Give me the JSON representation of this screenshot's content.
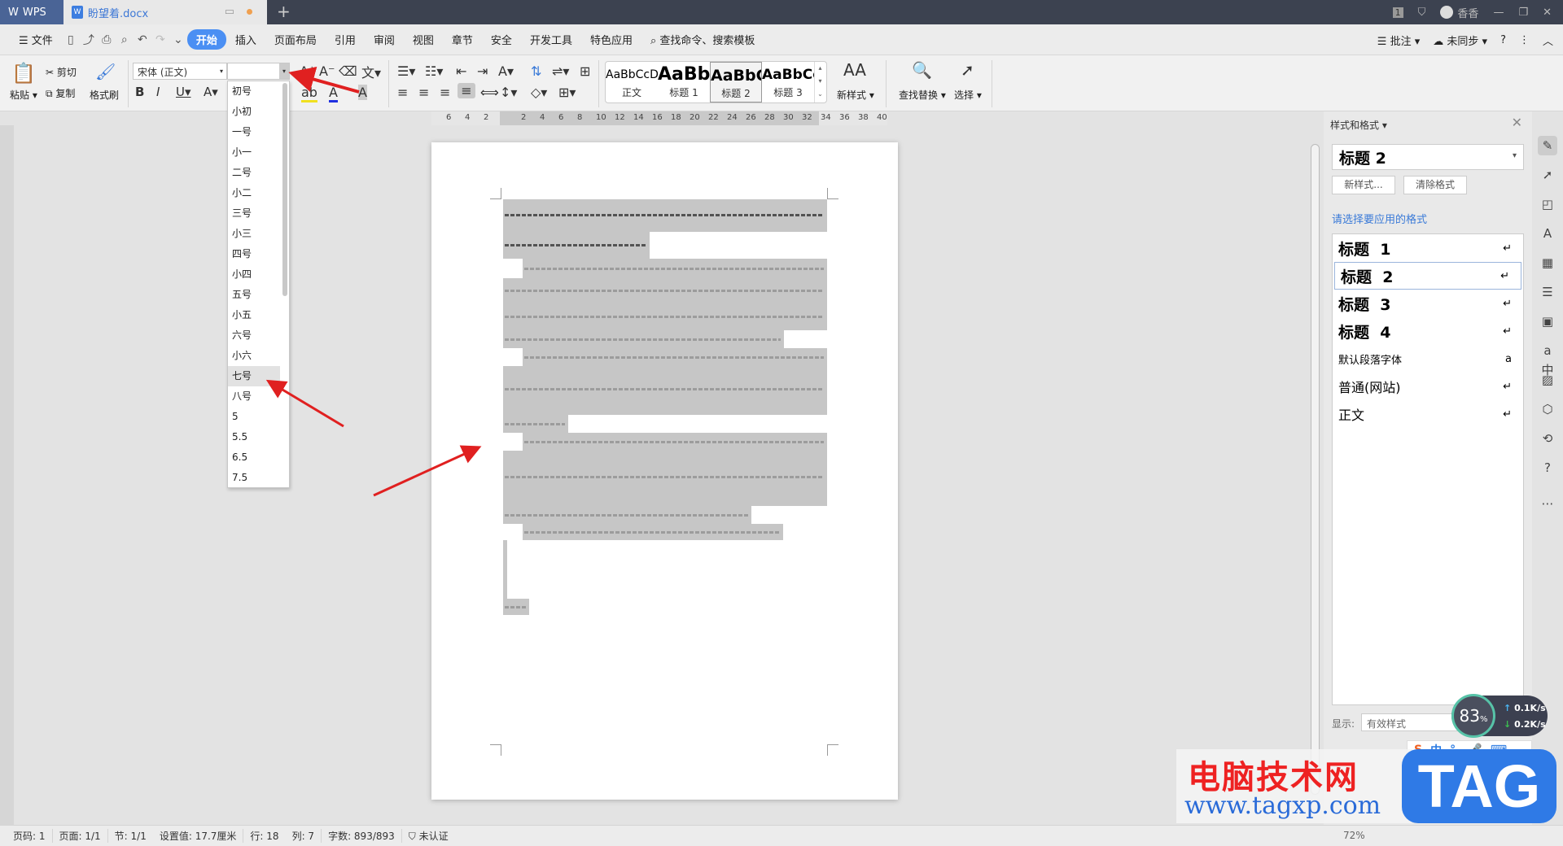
{
  "titlebar": {
    "app": "WPS",
    "doc_tab": "盼望着.docx",
    "user": "香香",
    "badge": "1"
  },
  "menu": {
    "file": "文件",
    "items": [
      "开始",
      "插入",
      "页面布局",
      "引用",
      "审阅",
      "视图",
      "章节",
      "安全",
      "开发工具",
      "特色应用"
    ],
    "search": "查找命令、搜索模板",
    "comment": "批注",
    "sync": "未同步"
  },
  "ribbon": {
    "paste": "粘贴",
    "cut": "剪切",
    "copy": "复制",
    "format_painter": "格式刷",
    "font_name": "宋体 (正文)",
    "font_size": "",
    "find_replace": "查找替换",
    "select": "选择",
    "new_style": "新样式",
    "gallery": [
      {
        "sample": "AaBbCcD",
        "label": "正文"
      },
      {
        "sample": "AaBb",
        "label": "标题 1"
      },
      {
        "sample": "AaBbC",
        "label": "标题 2"
      },
      {
        "sample": "AaBbCc",
        "label": "标题 3"
      }
    ]
  },
  "ruler": {
    "ticks": [
      "6",
      "4",
      "2",
      "",
      "2",
      "4",
      "6",
      "8",
      "10",
      "12",
      "14",
      "16",
      "18",
      "20",
      "22",
      "24",
      "26",
      "28",
      "30",
      "32",
      "34",
      "36",
      "38",
      "40"
    ]
  },
  "font_size_dropdown": {
    "items": [
      "初号",
      "小初",
      "一号",
      "小一",
      "二号",
      "小二",
      "三号",
      "小三",
      "四号",
      "小四",
      "五号",
      "小五",
      "六号",
      "小六",
      "七号",
      "八号",
      "5",
      "5.5",
      "6.5",
      "7.5"
    ],
    "highlighted": "七号"
  },
  "styles_panel": {
    "title": "样式和格式",
    "current": "标题 2",
    "new_style_btn": "新样式...",
    "clear_btn": "清除格式",
    "prompt": "请选择要应用的格式",
    "styles": [
      {
        "name": "标题  1",
        "mark": "↵"
      },
      {
        "name": "标题  2",
        "mark": "↵"
      },
      {
        "name": "标题  3",
        "mark": "↵"
      },
      {
        "name": "标题  4",
        "mark": "↵"
      },
      {
        "name": "默认段落字体",
        "mark": "a"
      },
      {
        "name": "普通(网站)",
        "mark": "↵"
      },
      {
        "name": "正文",
        "mark": "↵"
      }
    ],
    "show_label": "显示:",
    "show_value": "有效样式"
  },
  "statusbar": {
    "page_no": "页码: 1",
    "pages": "页面: 1/1",
    "section": "节: 1/1",
    "setting": "设置值: 17.7厘米",
    "row": "行: 18",
    "col": "列: 7",
    "words": "字数: 893/893",
    "auth": "未认证",
    "zoom": "72%"
  },
  "net_widget": {
    "percent": "83",
    "pct_sign": "%",
    "up": "0.1K/s",
    "down": "0.2K/s"
  },
  "ime": {
    "lang": "中",
    "punct": "°,"
  },
  "watermark": {
    "site_cn": "电脑技术网",
    "url": "www.tagxp.com",
    "logo": "TAG"
  },
  "colors": {
    "accent": "#4b8ff3",
    "arrow": "#e02020",
    "titlebar": "#3c4250"
  }
}
